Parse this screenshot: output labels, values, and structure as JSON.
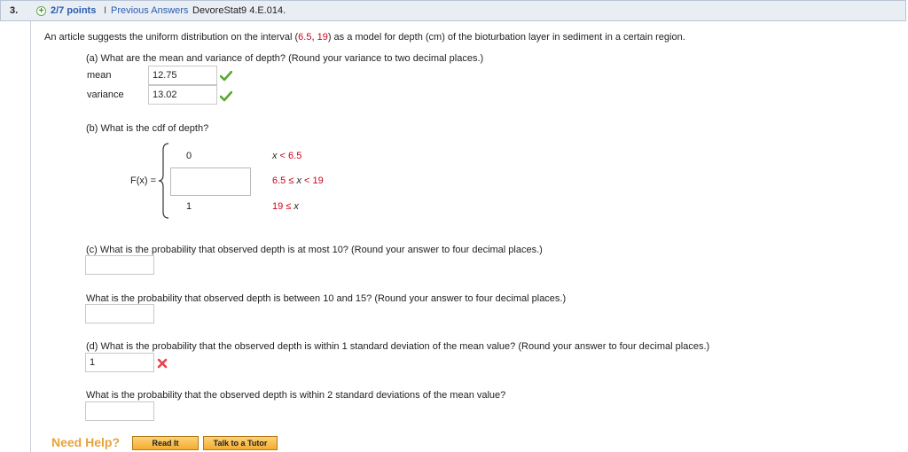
{
  "header": {
    "question_number": "3.",
    "points": "2/7 points",
    "separator": "I",
    "previous_answers": "Previous Answers",
    "reference": "DevoreStat9 4.E.014."
  },
  "prompt": {
    "before": "An article suggests the uniform distribution on the interval (",
    "a": "6.5",
    "comma": ", ",
    "b": "19",
    "after": ") as a model for depth (cm) of the bioturbation layer in sediment in a certain region."
  },
  "part_a": {
    "question": "(a) What are the mean and variance of depth? (Round your variance to two decimal places.)",
    "mean_label": "mean",
    "mean_value": "12.75",
    "variance_label": "variance",
    "variance_value": "13.02"
  },
  "part_b": {
    "question": "(b) What is the cdf of depth?",
    "fx_label": "F(x) =",
    "case1_value": "0",
    "case1_cond_x": "x",
    "case1_cond_rest": " < 6.5",
    "case2_cond": "6.5 ≤ ",
    "case2_x": "x",
    "case2_rest": " < 19",
    "case3_value": "1",
    "case3_cond": "19 ≤ ",
    "case3_x": "x"
  },
  "part_c": {
    "question1": "(c) What is the probability that observed depth is at most 10? (Round your answer to four decimal places.)",
    "answer1": "",
    "question2": "What is the probability that observed depth is between 10 and 15? (Round your answer to four decimal places.)",
    "answer2": ""
  },
  "part_d": {
    "question1": "(d) What is the probability that the observed depth is within 1 standard deviation of the mean value? (Round your answer to four decimal places.)",
    "answer1": "1",
    "question2": "What is the probability that the observed depth is within 2 standard deviations of the mean value?",
    "answer2": ""
  },
  "help": {
    "need_help": "Need Help?",
    "read_it": "Read It",
    "talk_to_tutor": "Talk to a Tutor"
  },
  "colors": {
    "link_blue": "#2a5db0",
    "highlight_red": "#d0021b",
    "correct_green": "#5aa832",
    "incorrect_red": "#e8424a",
    "help_orange": "#e8a33a"
  }
}
